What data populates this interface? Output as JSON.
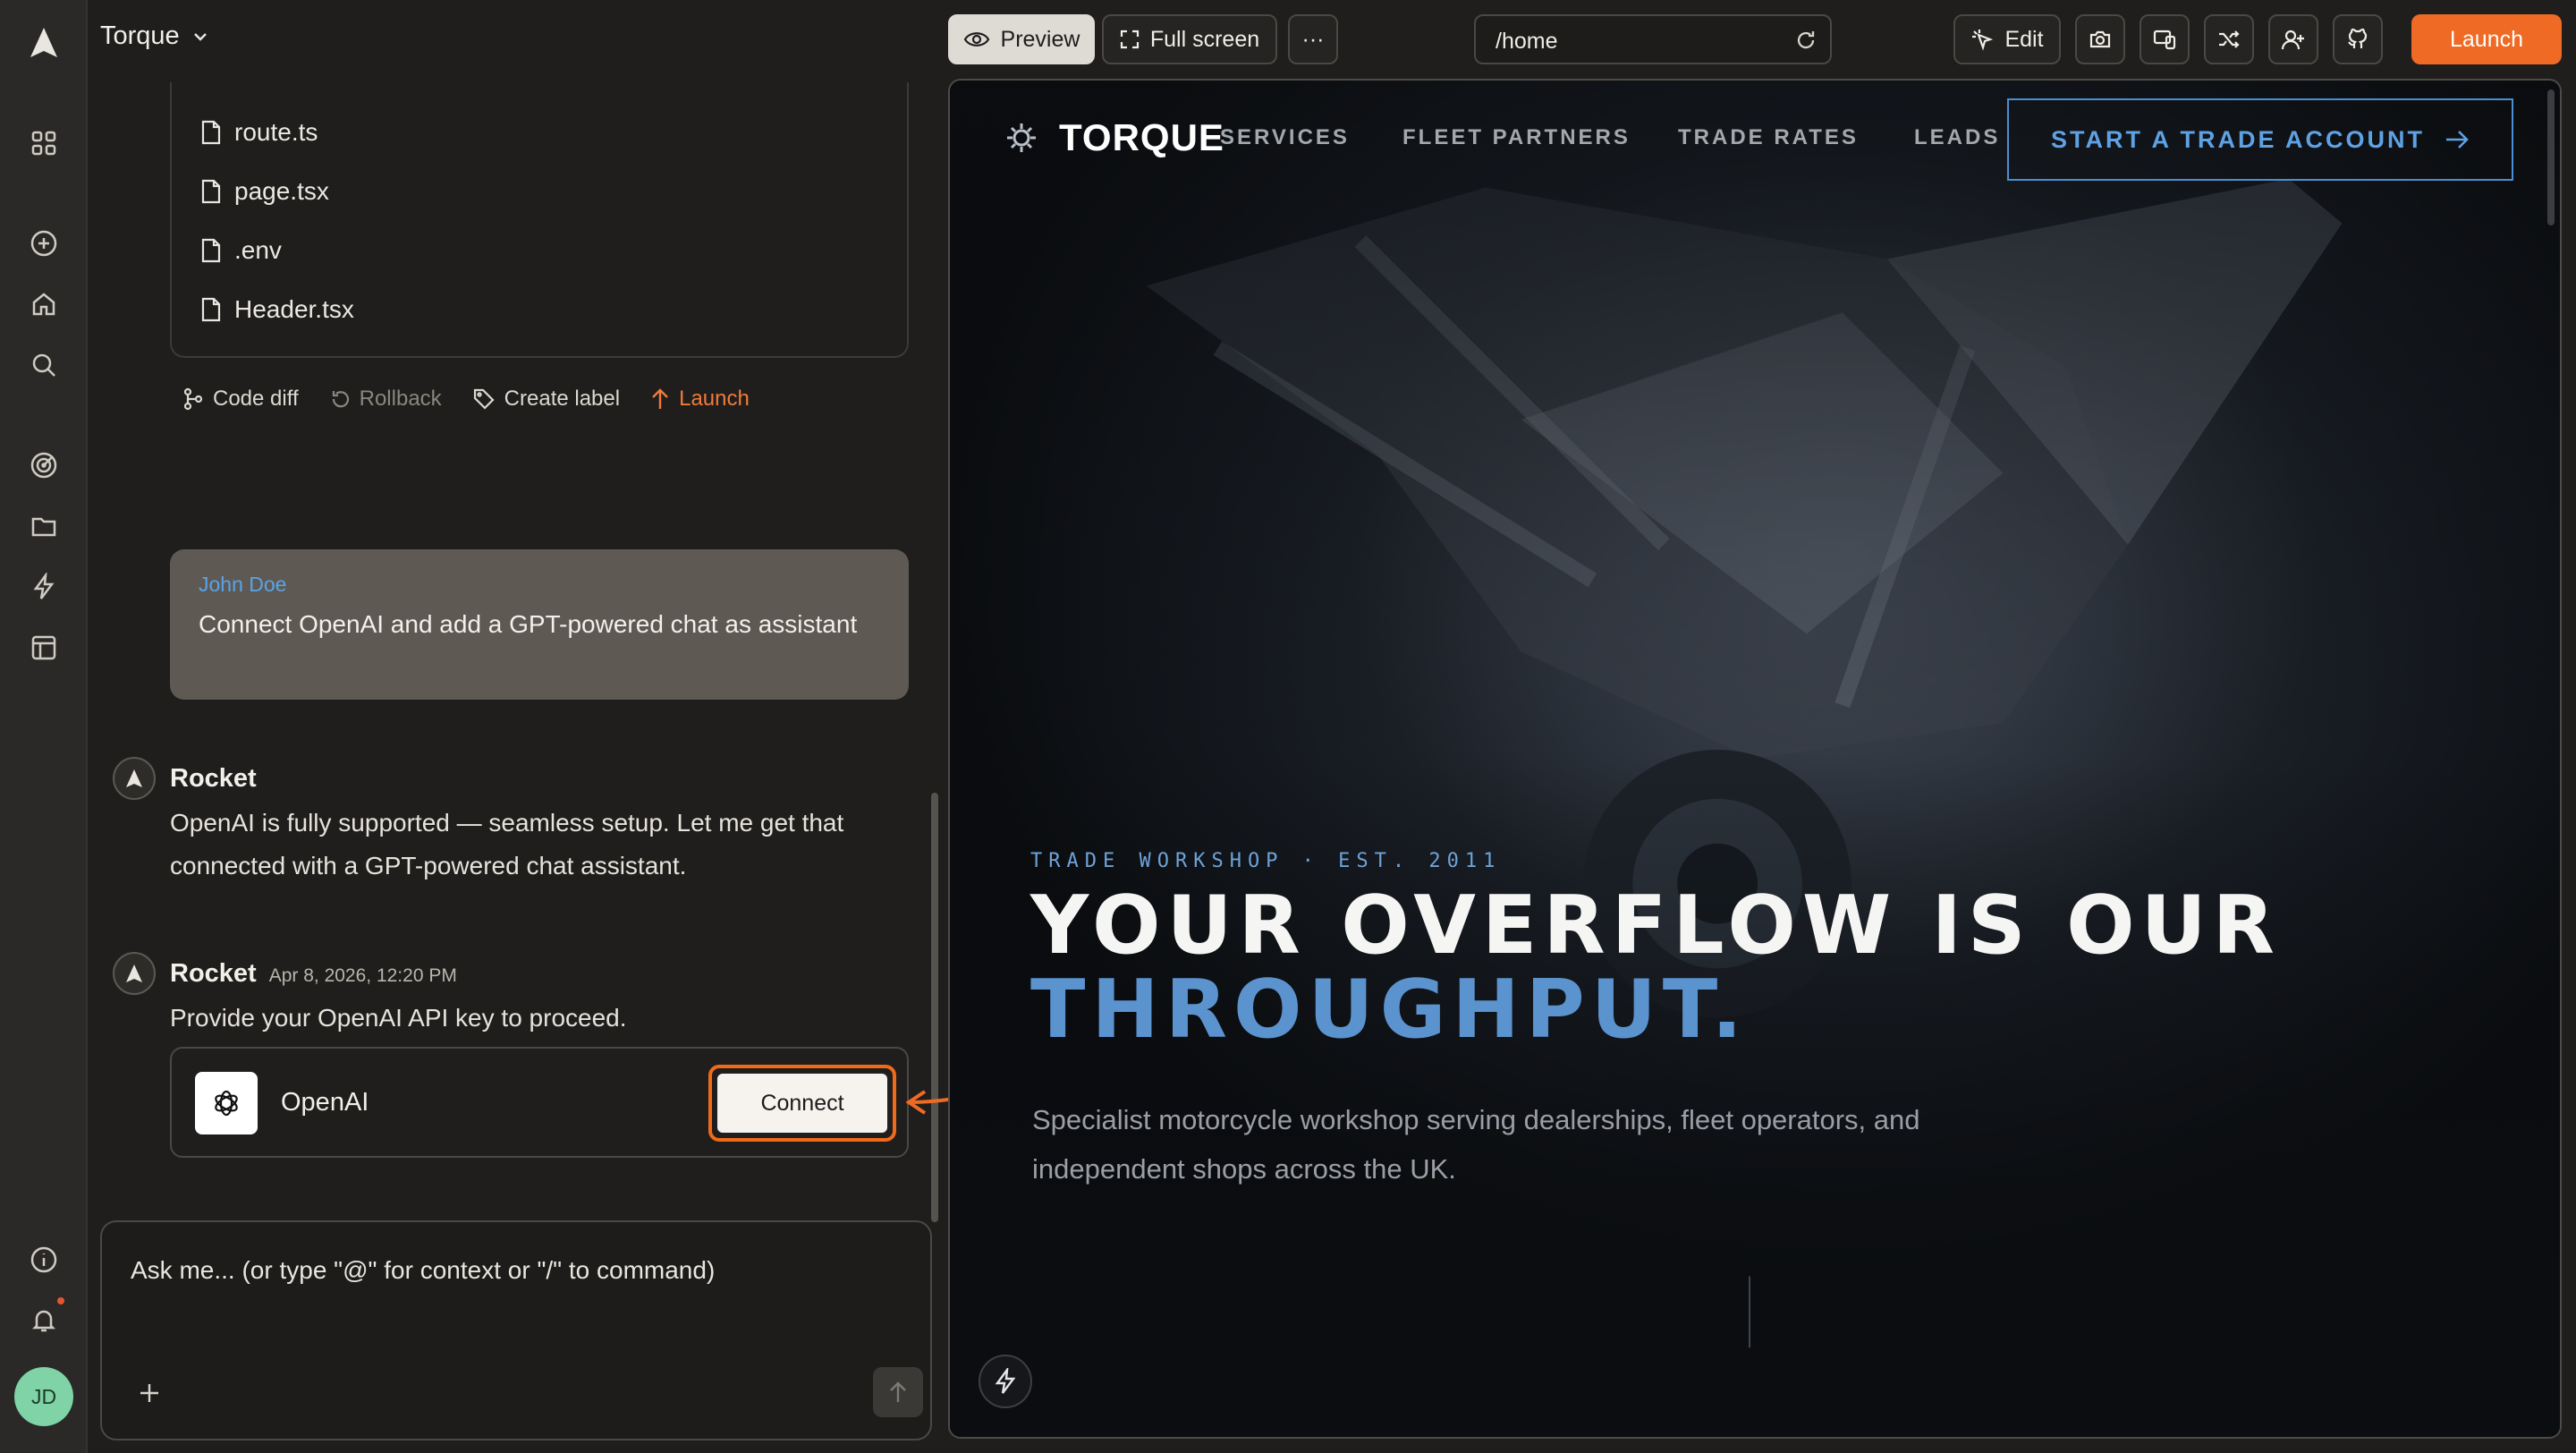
{
  "app": {
    "project_name": "Torque"
  },
  "rail": {
    "icons": [
      "rocket-logo-icon",
      "apps-grid-icon",
      "add-circle-icon",
      "home-icon",
      "search-icon",
      "target-icon",
      "folder-icon",
      "bolt-icon",
      "layout-icon",
      "info-icon",
      "bell-icon"
    ],
    "avatar_initials": "JD",
    "avatar_color": "#7fd3a6"
  },
  "files": [
    {
      "name": "route.ts"
    },
    {
      "name": "page.tsx"
    },
    {
      "name": ".env"
    },
    {
      "name": "Header.tsx"
    }
  ],
  "file_actions": {
    "code_diff": "Code diff",
    "rollback": "Rollback",
    "create_label": "Create label",
    "launch": "Launch"
  },
  "messages": {
    "user": {
      "name": "John Doe",
      "text": "Connect OpenAI and add a GPT-powered chat as assistant"
    },
    "bot1": {
      "name": "Rocket",
      "text": "OpenAI is fully supported — seamless setup. Let me get that connected with a GPT-powered chat assistant."
    },
    "bot2": {
      "name": "Rocket",
      "time": "Apr 8, 2026, 12:20 PM",
      "text": "Provide your OpenAI API key to proceed."
    }
  },
  "integration": {
    "name": "OpenAI",
    "button": "Connect"
  },
  "composer": {
    "placeholder": "Ask me... (or type \"@\" for context or \"/\" to command)"
  },
  "toolbar": {
    "preview": "Preview",
    "fullscreen": "Full screen",
    "more": "···",
    "url": "/home",
    "edit": "Edit",
    "launch": "Launch",
    "accent_color": "#ef6a24"
  },
  "site": {
    "brand": "TORQUE",
    "nav": [
      "SERVICES",
      "FLEET PARTNERS",
      "TRADE RATES",
      "LEADS"
    ],
    "cta": "START A TRADE ACCOUNT",
    "eyebrow": "TRADE WORKSHOP · EST. 2011",
    "headline_1": "YOUR OVERFLOW IS OUR",
    "headline_2": "THROUGHPUT.",
    "subcopy": "Specialist motorcycle workshop serving dealerships, fleet operators, and independent shops across the UK.",
    "accent_color": "#5b93cf"
  }
}
